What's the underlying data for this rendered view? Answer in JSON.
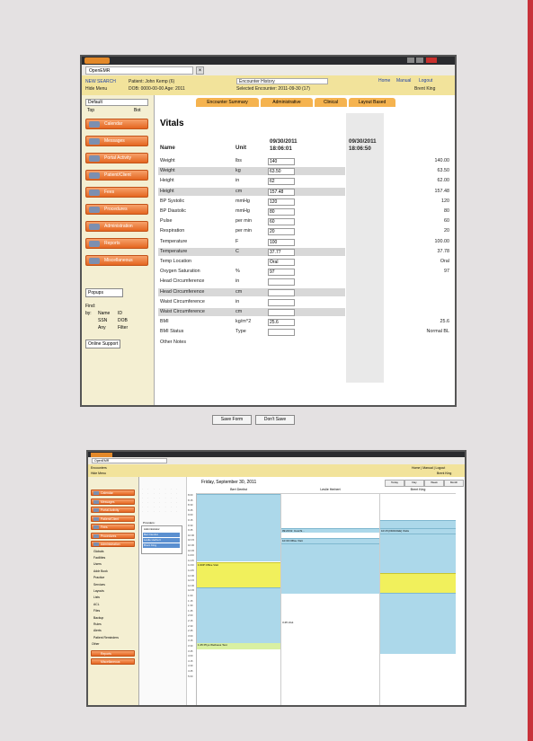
{
  "shot1": {
    "window": {
      "tab_label": "OpenEMR",
      "tab_close": "×"
    },
    "header": {
      "new_search": "NEW SEARCH",
      "hide_menu": "Hide Menu",
      "patient": "Patient: John Kemp (6)",
      "dob": "DOB: 0000-00-00 Age: 2011",
      "encounter_select": "Encounter History",
      "selected_encounter": "Selected Encounter: 2011-09-30 (17)",
      "home": "Home",
      "manual": "Manual",
      "logout": "Logout",
      "user": "Brent King"
    },
    "sidebar": {
      "dropdown": "Default",
      "top_label": "Top",
      "bot_label": "Bot",
      "items": [
        {
          "label": "Calendar"
        },
        {
          "label": "Messages"
        },
        {
          "label": "Portal Activity"
        },
        {
          "label": "Patient/Client"
        },
        {
          "label": "Fees"
        },
        {
          "label": "Procedures"
        },
        {
          "label": "Administration"
        },
        {
          "label": "Reports"
        },
        {
          "label": "Miscellaneous"
        }
      ],
      "popups": "Popups",
      "find": "Find:",
      "by": "by:",
      "name": "Name",
      "id": "ID",
      "ssn": "SSN",
      "dob": "DOB",
      "any": "Any",
      "filter": "Filter",
      "online_support": "Online Support"
    },
    "subtabs": [
      "Encounter Summary",
      "Administrative",
      "Clinical",
      "Layout Based"
    ],
    "vitals": {
      "title": "Vitals",
      "col_name": "Name",
      "col_unit": "Unit",
      "col_current": "09/30/2011\n18:06:01",
      "col_prev": "09/30/2011\n18:06:50",
      "rows": [
        {
          "name": "Weight",
          "unit": "lbs",
          "value": "140",
          "prev": "140.00",
          "shade": false
        },
        {
          "name": "Weight",
          "unit": "kg",
          "value": "63.50",
          "prev": "63.50",
          "shade": true
        },
        {
          "name": "Height",
          "unit": "in",
          "value": "62",
          "prev": "62.00",
          "shade": false
        },
        {
          "name": "Height",
          "unit": "cm",
          "value": "157.48",
          "prev": "157.48",
          "shade": true
        },
        {
          "name": "BP Systolic",
          "unit": "mmHg",
          "value": "120",
          "prev": "120",
          "shade": false
        },
        {
          "name": "BP Diastolic",
          "unit": "mmHg",
          "value": "80",
          "prev": "80",
          "shade": false
        },
        {
          "name": "Pulse",
          "unit": "per min",
          "value": "60",
          "prev": "60",
          "shade": false
        },
        {
          "name": "Respiration",
          "unit": "per min",
          "value": "20",
          "prev": "20",
          "shade": false
        },
        {
          "name": "Temperature",
          "unit": "F",
          "value": "100",
          "prev": "100.00",
          "shade": false
        },
        {
          "name": "Temperature",
          "unit": "C",
          "value": "37.77",
          "prev": "37.78",
          "shade": true
        },
        {
          "name": "Temp Location",
          "unit": "",
          "value": "Oral",
          "prev": "Oral",
          "shade": false
        },
        {
          "name": "Oxygen Saturation",
          "unit": "%",
          "value": "97",
          "prev": "97",
          "shade": false
        },
        {
          "name": "Head Circumference",
          "unit": "in",
          "value": "",
          "prev": "",
          "shade": false
        },
        {
          "name": "Head Circumference",
          "unit": "cm",
          "value": "",
          "prev": "",
          "shade": true
        },
        {
          "name": "Waist Circumference",
          "unit": "in",
          "value": "",
          "prev": "",
          "shade": false
        },
        {
          "name": "Waist Circumference",
          "unit": "cm",
          "value": "",
          "prev": "",
          "shade": true
        },
        {
          "name": "BMI",
          "unit": "kg/m^2",
          "value": "25.6",
          "prev": "25.6",
          "shade": false
        },
        {
          "name": "BMI Status",
          "unit": "Type",
          "value": "",
          "prev": "Normal BL",
          "shade": false
        },
        {
          "name": "Other Notes",
          "unit": "",
          "value": "",
          "prev": "",
          "shade": false
        }
      ],
      "save": "Save Form",
      "dont_save": "Don't Save"
    }
  },
  "shot2": {
    "tab_label": "OpenEMR",
    "header": {
      "encounters": "Encounters",
      "hide_menu": "Hide Menu",
      "right_links": "Home | Manual | Logout",
      "user": "Brent King"
    },
    "sidebar": {
      "items": [
        "Calendar",
        "Messages",
        "Portal Activity",
        "Patient/Client",
        "Fees",
        "Procedures",
        "Administration"
      ],
      "sub_items": [
        "Globals",
        "Facilities",
        "Users",
        "Addr Book",
        "Practice",
        "Services",
        "Layouts",
        "Lists",
        "ACL",
        "Files",
        "Backup",
        "Rules",
        "Alerts",
        "Patient Reminders"
      ],
      "other": "Other",
      "reports": "Reports",
      "misc": "Miscellaneous"
    },
    "calendar": {
      "date_header": "Friday, September 30, 2011",
      "nav": [
        "Today",
        "Day",
        "Week",
        "Month"
      ],
      "columns": [
        "Bert Dentist",
        "Leslie Herbert",
        "Brent King"
      ],
      "providers_label": "Providers:",
      "providers": [
        "Administrator",
        "Bert Dentist",
        "Leslie Herbert",
        "Brent King"
      ],
      "events": [
        "1:00P  Office Visit",
        "09:20  Dr. Cocchi...",
        "10:30  Office Visit",
        "1:45  Phys Wellness Test",
        "10:15  [ORANGE] Visits",
        "3:45  Visit"
      ],
      "times": [
        "8:00",
        "8:15",
        "8:30",
        "8:45",
        "9:00",
        "9:15",
        "9:30",
        "9:45",
        "10:00",
        "10:15",
        "10:30",
        "10:45",
        "11:00",
        "11:15",
        "11:30",
        "11:45",
        "12:00",
        "12:15",
        "12:30",
        "12:45",
        "1:00",
        "1:15",
        "1:30",
        "1:45",
        "2:00",
        "2:15",
        "2:30",
        "2:45",
        "3:00",
        "3:15",
        "3:30",
        "3:45",
        "4:00",
        "4:15",
        "4:30",
        "4:45",
        "5:00"
      ]
    }
  }
}
